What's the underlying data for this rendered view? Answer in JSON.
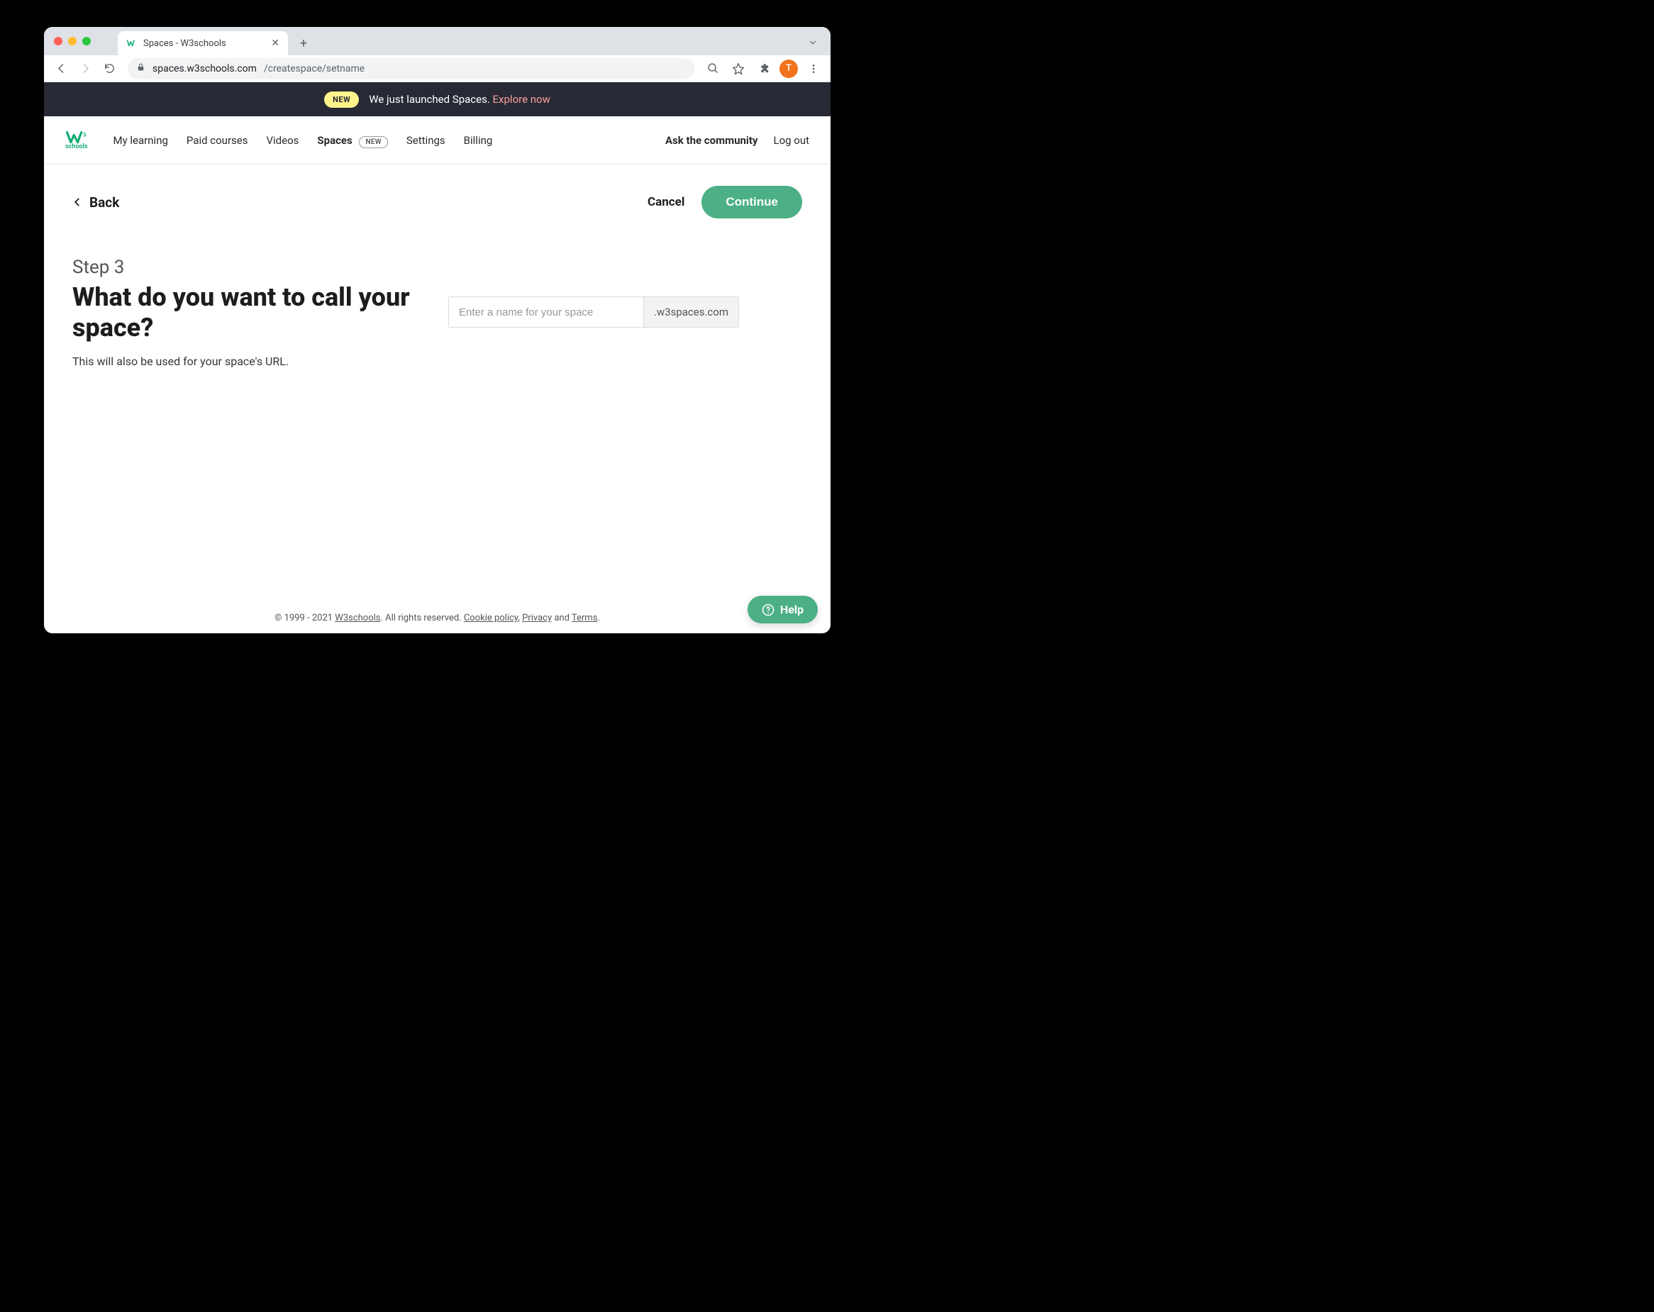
{
  "browser": {
    "tab_title": "Spaces - W3schools",
    "url_host": "spaces.w3schools.com",
    "url_path": "/createspace/setname",
    "avatar_initial": "T"
  },
  "announcement": {
    "badge": "NEW",
    "text": "We just launched Spaces. ",
    "link_text": "Explore now"
  },
  "logo": {
    "sub": "schools"
  },
  "nav": {
    "items": [
      {
        "label": "My learning"
      },
      {
        "label": "Paid courses"
      },
      {
        "label": "Videos"
      },
      {
        "label": "Spaces",
        "active": true,
        "badge": "NEW"
      },
      {
        "label": "Settings"
      },
      {
        "label": "Billing"
      }
    ],
    "right": [
      {
        "label": "Ask the community",
        "bold": true
      },
      {
        "label": "Log out"
      }
    ]
  },
  "page": {
    "back_label": "Back",
    "cancel_label": "Cancel",
    "continue_label": "Continue",
    "step_label": "Step 3",
    "heading": "What do you want to call your space?",
    "subtext": "This will also be used for your space's URL.",
    "input_placeholder": "Enter a name for your space",
    "input_value": "",
    "domain_suffix": ".w3spaces.com"
  },
  "footer": {
    "copyright": "© 1999 - 2021 ",
    "brand": "W3schools",
    "rights": ". All rights reserved. ",
    "cookie": "Cookie policy",
    "sep1": ", ",
    "privacy": "Privacy",
    "and": " and ",
    "terms": "Terms",
    "end": "."
  },
  "help": {
    "label": "Help"
  }
}
